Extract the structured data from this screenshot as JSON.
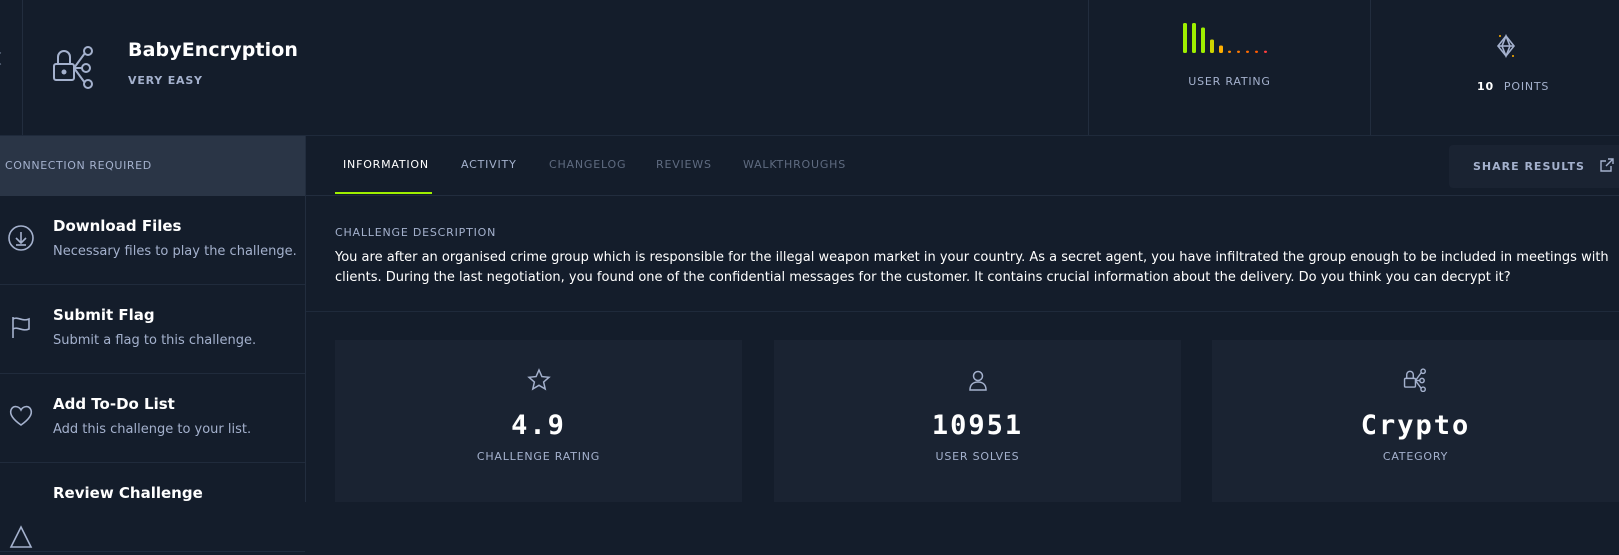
{
  "challenge": {
    "title": "BabyEncryption",
    "difficulty": "VERY EASY",
    "icon": "lock-share-icon"
  },
  "rating": {
    "label": "USER RATING",
    "bar_levels": [
      1.0,
      1.0,
      0.85,
      0.45,
      0.25,
      0.08,
      0.08,
      0.08,
      0.08,
      0.08
    ],
    "colors": [
      "#9fef00",
      "#9fef00",
      "#9fef00",
      "#cfd400",
      "#ffaf00",
      "#ff8a00",
      "#ff7a00",
      "#ff6a00",
      "#ff5a00",
      "#ff3e3e"
    ]
  },
  "points": {
    "value": "10",
    "label": "POINTS",
    "icon": "diamond-icon"
  },
  "sidebar": {
    "connection_label": "CONNECTION REQUIRED",
    "items": [
      {
        "title": "Download Files",
        "desc": "Necessary files to play the challenge.",
        "icon": "download-icon"
      },
      {
        "title": "Submit Flag",
        "desc": "Submit a flag to this challenge.",
        "icon": "flag-icon"
      },
      {
        "title": "Add To-Do List",
        "desc": "Add this challenge to your list.",
        "icon": "heart-icon"
      },
      {
        "title": "Review Challenge",
        "desc": "",
        "icon": "review-icon"
      }
    ]
  },
  "tabs": [
    "INFORMATION",
    "ACTIVITY",
    "CHANGELOG",
    "REVIEWS",
    "WALKTHROUGHS"
  ],
  "share_button": "SHARE RESULTS",
  "description": {
    "title": "CHALLENGE DESCRIPTION",
    "text": "You are after an organised crime group which is responsible for the illegal weapon market in your country. As a secret agent, you have infiltrated the group enough to be included in meetings with clients. During the last negotiation, you found one of the confidential messages for the customer. It contains crucial information about the delivery. Do you think you can decrypt it?"
  },
  "stats": [
    {
      "value": "4.9",
      "label": "CHALLENGE RATING",
      "icon": "star-icon"
    },
    {
      "value": "10951",
      "label": "USER SOLVES",
      "icon": "user-icon"
    },
    {
      "value": "Crypto",
      "label": "CATEGORY",
      "icon": "lock-share-icon"
    }
  ],
  "colors": {
    "accent": "#9fef00",
    "background": "#141d2b",
    "card": "#1a2332",
    "muted": "#a4b1cd"
  }
}
